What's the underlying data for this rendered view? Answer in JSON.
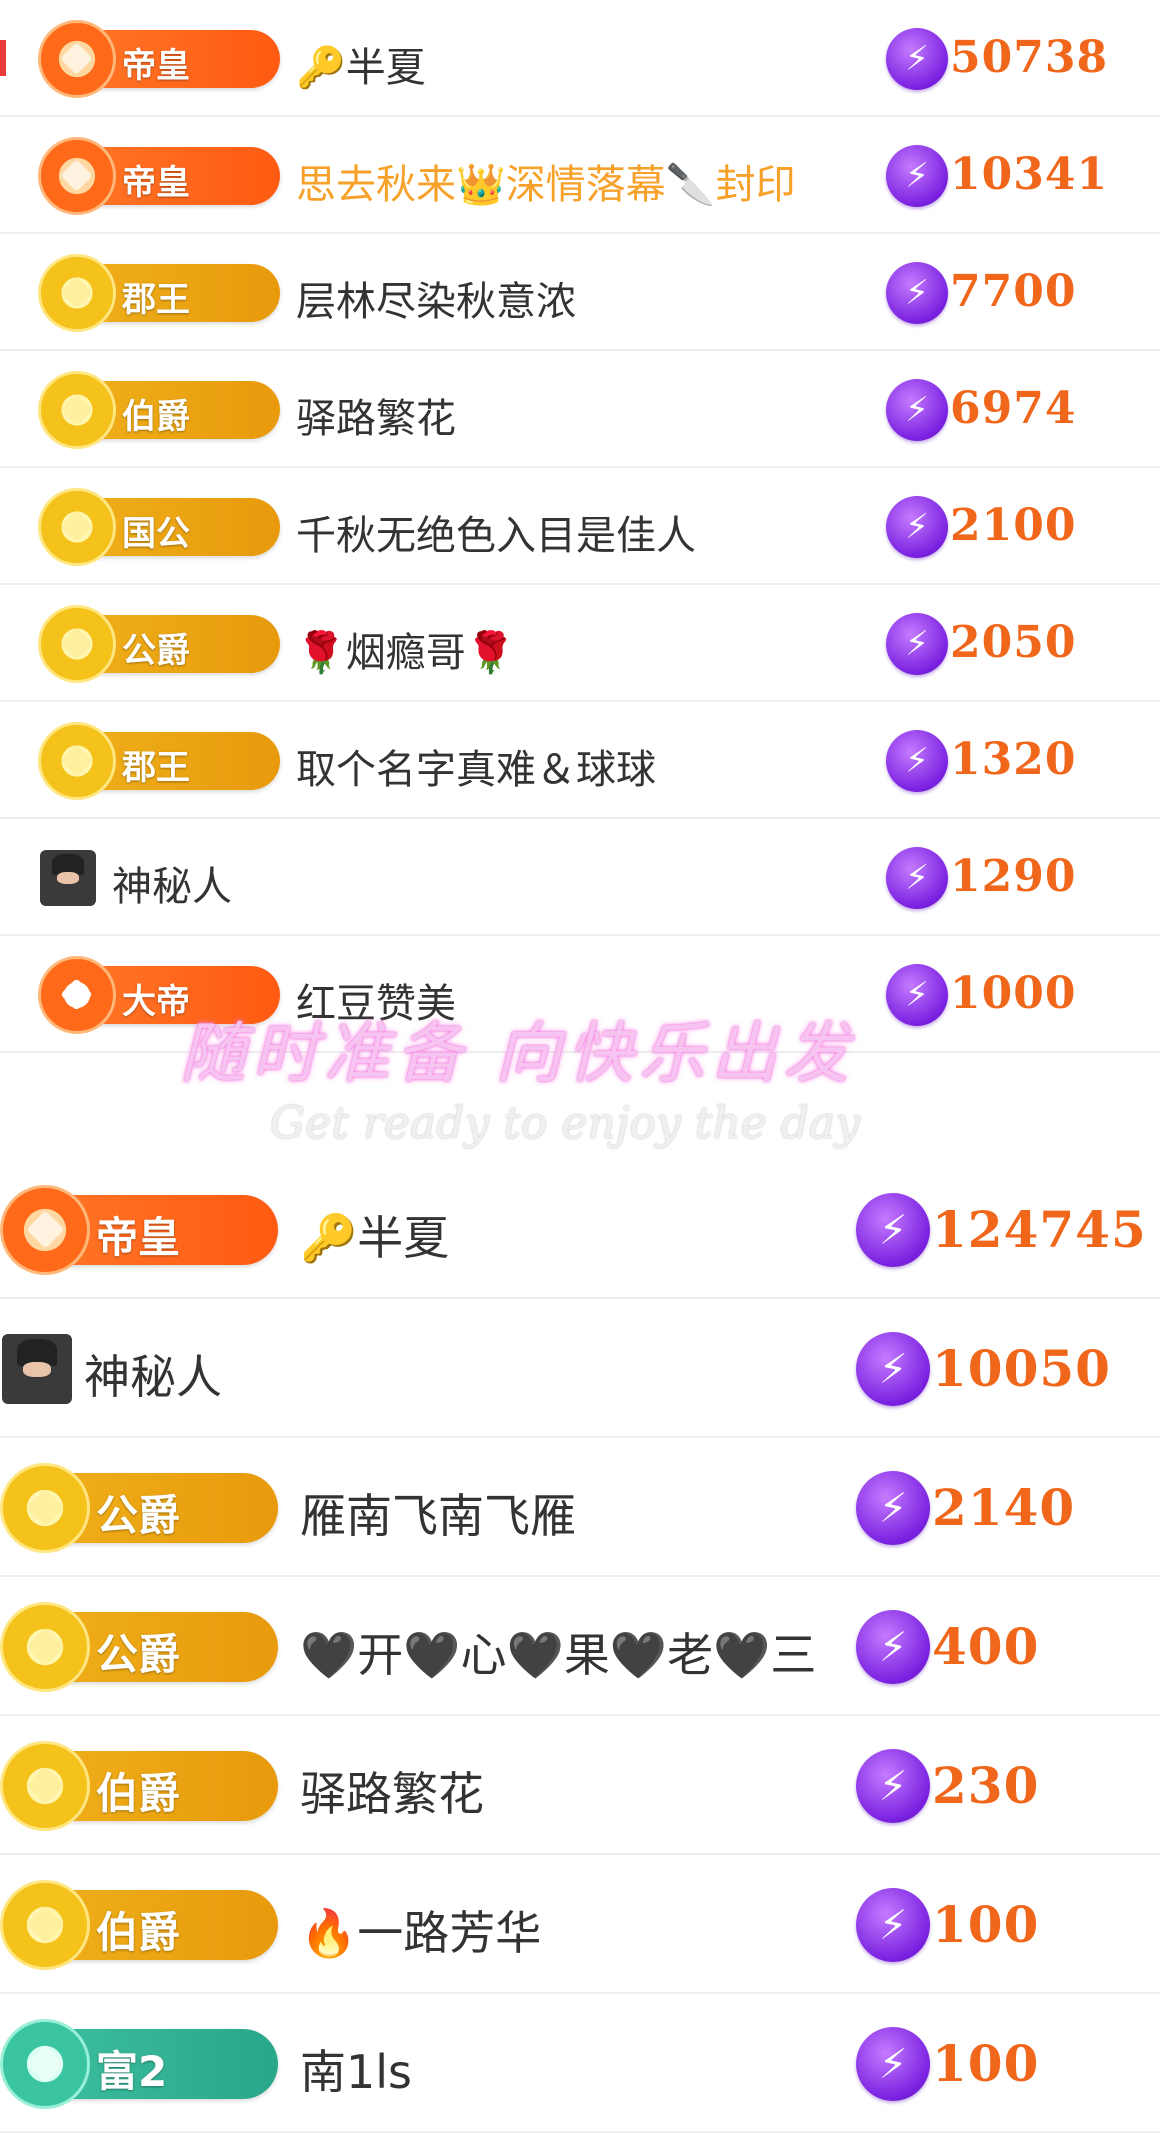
{
  "list_top": [
    {
      "badge": "帝皇",
      "badge_style": "emperor",
      "name": "🔑半夏",
      "score": "50738"
    },
    {
      "badge": "帝皇",
      "badge_style": "emperor",
      "name": "思去秋来👑深情落幕🔪封印",
      "score": "10341"
    },
    {
      "badge": "郡王",
      "badge_style": "gold",
      "name": "层林尽染秋意浓",
      "score": "7700"
    },
    {
      "badge": "伯爵",
      "badge_style": "gold",
      "name": "驿路繁花",
      "score": "6974"
    },
    {
      "badge": "国公",
      "badge_style": "gold",
      "name": "千秋无绝色入目是佳人",
      "score": "2100"
    },
    {
      "badge": "公爵",
      "badge_style": "gold",
      "name": "🌹烟瘾哥🌹",
      "score": "2050"
    },
    {
      "badge": "郡王",
      "badge_style": "gold",
      "name": "取个名字真难＆球球",
      "score": "1320"
    },
    {
      "badge": "",
      "badge_style": "anon",
      "name": "神秘人",
      "score": "1290"
    },
    {
      "badge": "大帝",
      "badge_style": "dadi",
      "name": "红豆赞美",
      "score": "1000"
    }
  ],
  "watermark": {
    "cn": "随时准备 向快乐出发",
    "en": "Get ready to enjoy the day"
  },
  "list_bottom": [
    {
      "badge": "帝皇",
      "badge_style": "emperor",
      "name": "🔑半夏",
      "score": "124745"
    },
    {
      "badge": "",
      "badge_style": "anon",
      "name": "神秘人",
      "score": "10050"
    },
    {
      "badge": "公爵",
      "badge_style": "gold",
      "name": "雁南飞南飞雁",
      "score": "2140"
    },
    {
      "badge": "公爵",
      "badge_style": "gold",
      "name": "🖤开🖤心🖤果🖤老🖤三",
      "score": "400"
    },
    {
      "badge": "伯爵",
      "badge_style": "gold",
      "name": "驿路繁花",
      "score": "230"
    },
    {
      "badge": "伯爵",
      "badge_style": "gold",
      "name": "🔥一路芳华",
      "score": "100"
    },
    {
      "badge": "富2",
      "badge_style": "rich",
      "name": "南1ls",
      "score": "100"
    }
  ],
  "icons": {
    "bolt": "lightning-icon",
    "avatar": "anonymous-avatar-icon"
  },
  "colors": {
    "score": "#f0661a",
    "bolt_bg": "#7a21e0",
    "gold_badge": "#f0b21c",
    "emperor_badge": "#ff6a1a",
    "rich_badge": "#2aa68a",
    "highlight_name": "#f7a12a"
  }
}
